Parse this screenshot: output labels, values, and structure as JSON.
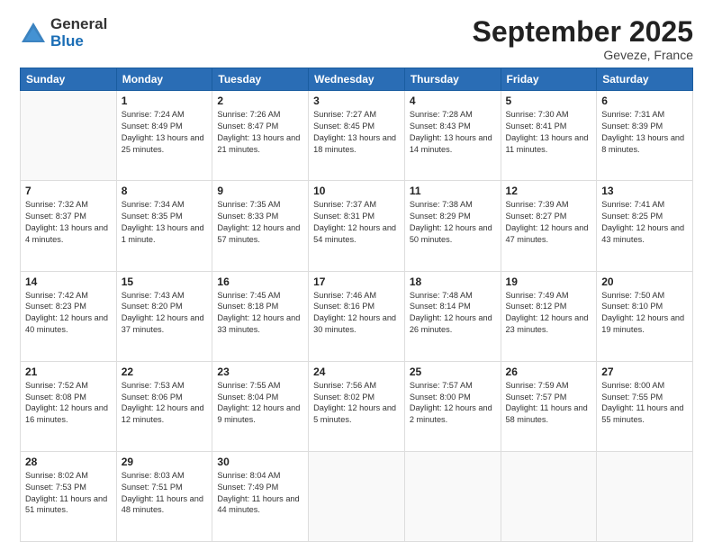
{
  "logo": {
    "general": "General",
    "blue": "Blue"
  },
  "header": {
    "title": "September 2025",
    "location": "Geveze, France"
  },
  "weekdays": [
    "Sunday",
    "Monday",
    "Tuesday",
    "Wednesday",
    "Thursday",
    "Friday",
    "Saturday"
  ],
  "weeks": [
    [
      {
        "day": "",
        "sunrise": "",
        "sunset": "",
        "daylight": ""
      },
      {
        "day": "1",
        "sunrise": "Sunrise: 7:24 AM",
        "sunset": "Sunset: 8:49 PM",
        "daylight": "Daylight: 13 hours and 25 minutes."
      },
      {
        "day": "2",
        "sunrise": "Sunrise: 7:26 AM",
        "sunset": "Sunset: 8:47 PM",
        "daylight": "Daylight: 13 hours and 21 minutes."
      },
      {
        "day": "3",
        "sunrise": "Sunrise: 7:27 AM",
        "sunset": "Sunset: 8:45 PM",
        "daylight": "Daylight: 13 hours and 18 minutes."
      },
      {
        "day": "4",
        "sunrise": "Sunrise: 7:28 AM",
        "sunset": "Sunset: 8:43 PM",
        "daylight": "Daylight: 13 hours and 14 minutes."
      },
      {
        "day": "5",
        "sunrise": "Sunrise: 7:30 AM",
        "sunset": "Sunset: 8:41 PM",
        "daylight": "Daylight: 13 hours and 11 minutes."
      },
      {
        "day": "6",
        "sunrise": "Sunrise: 7:31 AM",
        "sunset": "Sunset: 8:39 PM",
        "daylight": "Daylight: 13 hours and 8 minutes."
      }
    ],
    [
      {
        "day": "7",
        "sunrise": "Sunrise: 7:32 AM",
        "sunset": "Sunset: 8:37 PM",
        "daylight": "Daylight: 13 hours and 4 minutes."
      },
      {
        "day": "8",
        "sunrise": "Sunrise: 7:34 AM",
        "sunset": "Sunset: 8:35 PM",
        "daylight": "Daylight: 13 hours and 1 minute."
      },
      {
        "day": "9",
        "sunrise": "Sunrise: 7:35 AM",
        "sunset": "Sunset: 8:33 PM",
        "daylight": "Daylight: 12 hours and 57 minutes."
      },
      {
        "day": "10",
        "sunrise": "Sunrise: 7:37 AM",
        "sunset": "Sunset: 8:31 PM",
        "daylight": "Daylight: 12 hours and 54 minutes."
      },
      {
        "day": "11",
        "sunrise": "Sunrise: 7:38 AM",
        "sunset": "Sunset: 8:29 PM",
        "daylight": "Daylight: 12 hours and 50 minutes."
      },
      {
        "day": "12",
        "sunrise": "Sunrise: 7:39 AM",
        "sunset": "Sunset: 8:27 PM",
        "daylight": "Daylight: 12 hours and 47 minutes."
      },
      {
        "day": "13",
        "sunrise": "Sunrise: 7:41 AM",
        "sunset": "Sunset: 8:25 PM",
        "daylight": "Daylight: 12 hours and 43 minutes."
      }
    ],
    [
      {
        "day": "14",
        "sunrise": "Sunrise: 7:42 AM",
        "sunset": "Sunset: 8:23 PM",
        "daylight": "Daylight: 12 hours and 40 minutes."
      },
      {
        "day": "15",
        "sunrise": "Sunrise: 7:43 AM",
        "sunset": "Sunset: 8:20 PM",
        "daylight": "Daylight: 12 hours and 37 minutes."
      },
      {
        "day": "16",
        "sunrise": "Sunrise: 7:45 AM",
        "sunset": "Sunset: 8:18 PM",
        "daylight": "Daylight: 12 hours and 33 minutes."
      },
      {
        "day": "17",
        "sunrise": "Sunrise: 7:46 AM",
        "sunset": "Sunset: 8:16 PM",
        "daylight": "Daylight: 12 hours and 30 minutes."
      },
      {
        "day": "18",
        "sunrise": "Sunrise: 7:48 AM",
        "sunset": "Sunset: 8:14 PM",
        "daylight": "Daylight: 12 hours and 26 minutes."
      },
      {
        "day": "19",
        "sunrise": "Sunrise: 7:49 AM",
        "sunset": "Sunset: 8:12 PM",
        "daylight": "Daylight: 12 hours and 23 minutes."
      },
      {
        "day": "20",
        "sunrise": "Sunrise: 7:50 AM",
        "sunset": "Sunset: 8:10 PM",
        "daylight": "Daylight: 12 hours and 19 minutes."
      }
    ],
    [
      {
        "day": "21",
        "sunrise": "Sunrise: 7:52 AM",
        "sunset": "Sunset: 8:08 PM",
        "daylight": "Daylight: 12 hours and 16 minutes."
      },
      {
        "day": "22",
        "sunrise": "Sunrise: 7:53 AM",
        "sunset": "Sunset: 8:06 PM",
        "daylight": "Daylight: 12 hours and 12 minutes."
      },
      {
        "day": "23",
        "sunrise": "Sunrise: 7:55 AM",
        "sunset": "Sunset: 8:04 PM",
        "daylight": "Daylight: 12 hours and 9 minutes."
      },
      {
        "day": "24",
        "sunrise": "Sunrise: 7:56 AM",
        "sunset": "Sunset: 8:02 PM",
        "daylight": "Daylight: 12 hours and 5 minutes."
      },
      {
        "day": "25",
        "sunrise": "Sunrise: 7:57 AM",
        "sunset": "Sunset: 8:00 PM",
        "daylight": "Daylight: 12 hours and 2 minutes."
      },
      {
        "day": "26",
        "sunrise": "Sunrise: 7:59 AM",
        "sunset": "Sunset: 7:57 PM",
        "daylight": "Daylight: 11 hours and 58 minutes."
      },
      {
        "day": "27",
        "sunrise": "Sunrise: 8:00 AM",
        "sunset": "Sunset: 7:55 PM",
        "daylight": "Daylight: 11 hours and 55 minutes."
      }
    ],
    [
      {
        "day": "28",
        "sunrise": "Sunrise: 8:02 AM",
        "sunset": "Sunset: 7:53 PM",
        "daylight": "Daylight: 11 hours and 51 minutes."
      },
      {
        "day": "29",
        "sunrise": "Sunrise: 8:03 AM",
        "sunset": "Sunset: 7:51 PM",
        "daylight": "Daylight: 11 hours and 48 minutes."
      },
      {
        "day": "30",
        "sunrise": "Sunrise: 8:04 AM",
        "sunset": "Sunset: 7:49 PM",
        "daylight": "Daylight: 11 hours and 44 minutes."
      },
      {
        "day": "",
        "sunrise": "",
        "sunset": "",
        "daylight": ""
      },
      {
        "day": "",
        "sunrise": "",
        "sunset": "",
        "daylight": ""
      },
      {
        "day": "",
        "sunrise": "",
        "sunset": "",
        "daylight": ""
      },
      {
        "day": "",
        "sunrise": "",
        "sunset": "",
        "daylight": ""
      }
    ]
  ]
}
